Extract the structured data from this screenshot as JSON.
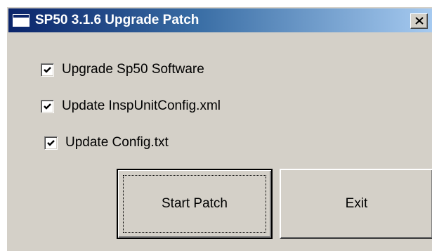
{
  "window": {
    "title": "SP50 3.1.6 Upgrade Patch",
    "app_icon": "window-icon",
    "close_icon": "close-icon"
  },
  "options": [
    {
      "label": "Upgrade Sp50 Software",
      "checked": true
    },
    {
      "label": "Update InspUnitConfig.xml",
      "checked": true
    },
    {
      "label": "Update Config.txt",
      "checked": true
    }
  ],
  "buttons": {
    "start_label": "Start Patch",
    "exit_label": "Exit"
  },
  "colors": {
    "titlebar_start": "#0a246a",
    "titlebar_end": "#a6caf0",
    "face": "#d4d0c8"
  }
}
